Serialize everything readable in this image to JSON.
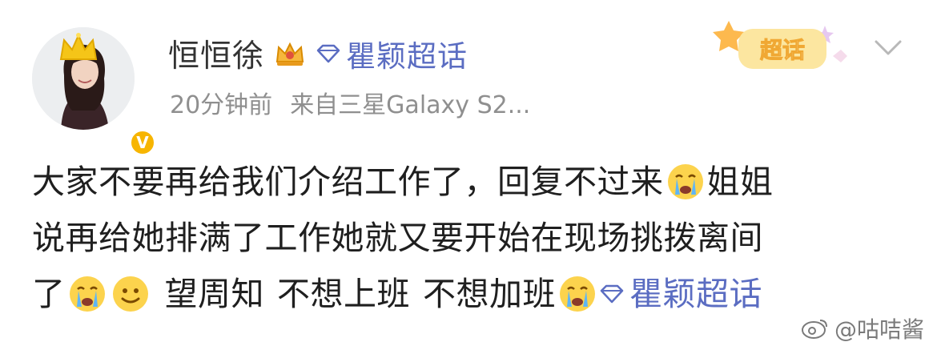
{
  "post": {
    "author": {
      "name": "恒恒徐",
      "verified_badge": "V"
    },
    "topic_tag": {
      "label": "瞿颖超话",
      "color": "#5b6dc2"
    },
    "meta": {
      "time": "20分钟前",
      "source": "来自三星Galaxy S2..."
    },
    "chaohua_badge": "超话",
    "content": {
      "line1": "大家不要再给我们介绍工作了，回复不过来",
      "line1_end": "姐姐",
      "line2": "说再给她排满了工作她就又要开始在现场挑拨离间",
      "line3_start": "了",
      "line3_mid1": "望周知",
      "line3_mid2": "不想上班",
      "line3_mid3": "不想加班",
      "line3_topic": "瞿颖超话"
    },
    "emoji": [
      "crying-face",
      "smile-face"
    ]
  },
  "watermark": {
    "text": "@咕咭酱"
  },
  "colors": {
    "accent": "#5b6dc2",
    "text": "#1f1f1f",
    "meta": "#8f8f8f",
    "gold": "#f7b500"
  }
}
